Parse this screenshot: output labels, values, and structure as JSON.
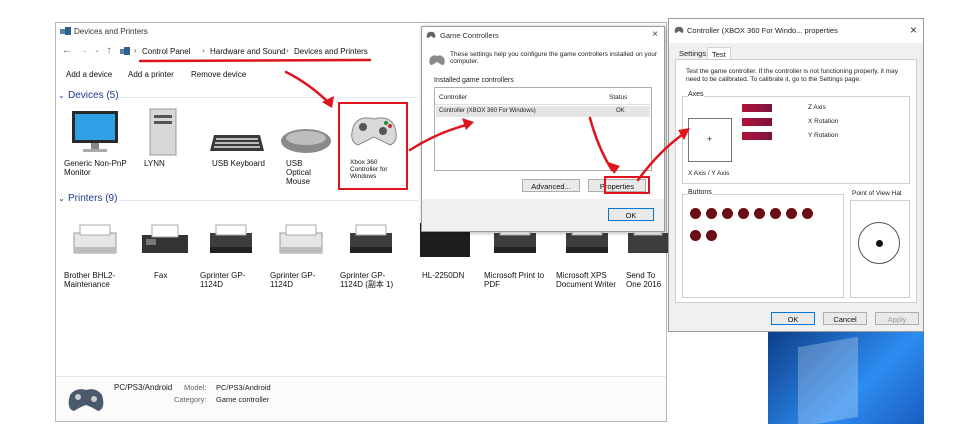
{
  "devices_window": {
    "title": "Devices and Printers",
    "breadcrumbs": [
      "Control Panel",
      "Hardware and Sound",
      "Devices and Printers"
    ],
    "toolbar": {
      "add_device": "Add a device",
      "add_printer": "Add a printer",
      "remove_device": "Remove device"
    },
    "devices_header": "Devices (5)",
    "devices": [
      {
        "label": "Generic Non-PnP Monitor",
        "icon": "monitor-icon"
      },
      {
        "label": "LYNN",
        "icon": "computer-tower-icon"
      },
      {
        "label": "USB Keyboard",
        "icon": "keyboard-icon"
      },
      {
        "label": "USB Optical Mouse",
        "icon": "mouse-icon"
      },
      {
        "label": "Xbox 360 Controller for Windows",
        "icon": "gamepad-icon"
      }
    ],
    "printers_header": "Printers (9)",
    "printers": [
      {
        "label": "Brother BHL2-Maintenance",
        "icon": "printer-icon"
      },
      {
        "label": "Fax",
        "icon": "fax-icon"
      },
      {
        "label": "Gprinter GP-1124D",
        "icon": "printer-icon"
      },
      {
        "label": "Gprinter GP-1124D",
        "icon": "printer-icon"
      },
      {
        "label": "Gprinter GP-1124D (副本 1)",
        "icon": "printer-icon"
      },
      {
        "label": "HL-2250DN",
        "icon": "printer-icon"
      },
      {
        "label": "Microsoft Print to PDF",
        "icon": "printer-icon"
      },
      {
        "label": "Microsoft XPS Document Writer",
        "icon": "printer-icon"
      },
      {
        "label": "Send To One 2016",
        "icon": "printer-icon"
      }
    ],
    "details": {
      "name": "PC/PS3/Android",
      "model_label": "Model:",
      "model_value": "PC/PS3/Android",
      "category_label": "Category:",
      "category_value": "Game controller"
    }
  },
  "game_controllers": {
    "title": "Game Controllers",
    "info": "These settings help you configure the game controllers installed on your computer.",
    "list_label": "Installed game controllers",
    "col_controller": "Controller",
    "col_status": "Status",
    "row_controller": "Controller (XBOX 360 For Windows)",
    "row_status": "OK",
    "advanced_btn": "Advanced...",
    "properties_btn": "Properties",
    "ok_btn": "OK"
  },
  "properties": {
    "title": "Controller (XBOX 360 For Windo... properties",
    "tab_settings": "Settings",
    "tab_test": "Test",
    "instructions": "Test the game controller.  If the controller is not functioning properly, it may need to be calibrated.  To calibrate it, go to the Settings page.",
    "axes_label": "Axes",
    "axis_names": [
      "Z Axis",
      "X Rotation",
      "Y Rotation"
    ],
    "xy_label": "X Axis / Y Axis",
    "buttons_label": "Buttons",
    "pov_label": "Point of View Hat",
    "button_count": 10,
    "ok_btn": "OK",
    "cancel_btn": "Cancel",
    "apply_btn": "Apply"
  },
  "colors": {
    "annotation_red": "#e0141c",
    "link_blue": "#1e3b8a",
    "button_red": "#6b0d14",
    "desktop_blue": "#1a6fd4"
  }
}
